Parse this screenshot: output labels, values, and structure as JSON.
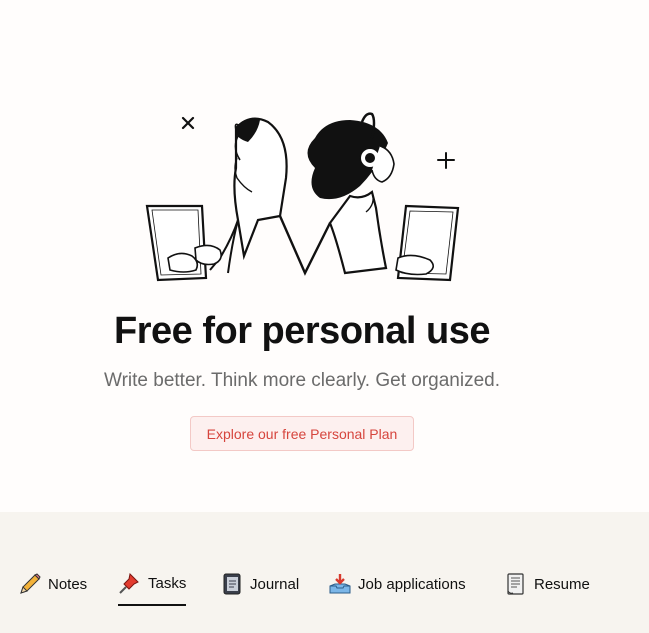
{
  "hero": {
    "headline": "Free for personal use",
    "subhead": "Write better. Think more clearly. Get organized.",
    "cta_label": "Explore our free Personal Plan"
  },
  "tabs": [
    {
      "label": "Notes",
      "icon": "pencil-icon",
      "active": false
    },
    {
      "label": "Tasks",
      "icon": "pushpin-icon",
      "active": true
    },
    {
      "label": "Journal",
      "icon": "notebook-icon",
      "active": false
    },
    {
      "label": "Job applications",
      "icon": "inbox-tray-icon",
      "active": false
    },
    {
      "label": "Resume",
      "icon": "scroll-icon",
      "active": false
    }
  ],
  "colors": {
    "cta_text": "#d6453d",
    "cta_background": "#fdf0ef",
    "band_background": "#f7f4ef"
  }
}
